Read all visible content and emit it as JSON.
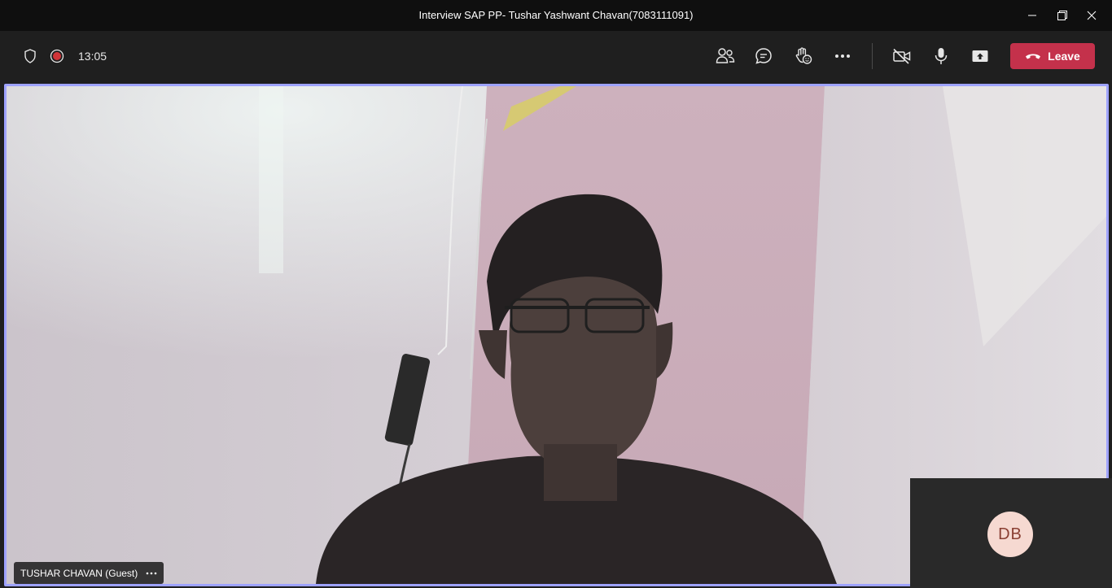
{
  "window": {
    "title": "Interview SAP PP- Tushar Yashwant Chavan(7083111091)",
    "controls": [
      "minimize-icon",
      "restore-icon",
      "close-icon"
    ]
  },
  "toolbar": {
    "left": {
      "shield_icon": "shield-icon",
      "recording_icon": "recording-icon",
      "timer": "13:05"
    },
    "controls": [
      {
        "name": "people-icon"
      },
      {
        "name": "chat-icon"
      },
      {
        "name": "raise-hand-icon"
      },
      {
        "name": "more-actions-icon"
      },
      {
        "name": "camera-off-icon"
      },
      {
        "name": "microphone-icon"
      },
      {
        "name": "share-screen-icon"
      }
    ],
    "leave_label": "Leave",
    "leave_color": "#c4314b"
  },
  "stage": {
    "border_color": "#9ea2ff",
    "participant_name": "TUSHAR CHAVAN (Guest)",
    "self_view": {
      "initials": "DB",
      "avatar_bg": "#f6d9d1",
      "avatar_fg": "#8a3f33"
    }
  }
}
